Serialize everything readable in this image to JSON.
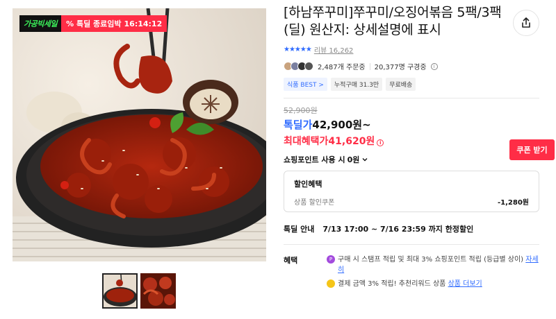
{
  "photo": {
    "promo_logo": "가공빅세일",
    "promo_label": "% 톡딜 종료임박",
    "promo_timer": "16:14:12"
  },
  "icons": {
    "share": "share-icon",
    "info": "info-icon",
    "chevron": "chevron-down-icon",
    "point": "point-badge-icon",
    "coin": "coin-icon"
  },
  "product": {
    "title": "[하남쭈꾸미]쭈꾸미/오징어볶음 5팩/3팩(딜) 원산지: 상세설명에 표시",
    "stars": "★★★★★",
    "review_label": "리뷰",
    "review_count": "16,262",
    "orders": "2,487개 주문중",
    "views": "20,377명 구경중",
    "tags": [
      "식품 BEST >",
      "누적구매 31.3만",
      "무료배송"
    ]
  },
  "price": {
    "original": "52,900원",
    "deal_label": "톡딜가",
    "deal_price": "42,900원~",
    "benefit_label": "최대혜택가",
    "benefit_price": "41,620원",
    "coupon_button": "쿠폰 받기",
    "points_label": "쇼핑포인트 사용 시",
    "points_value": "0원"
  },
  "discount": {
    "heading": "할인혜택",
    "item_label": "상품 할인쿠폰",
    "item_value": "-1,280원"
  },
  "deal_notice": {
    "label": "톡딜 안내",
    "period": "7/13 17:00 ~ 7/16 23:59 까지 한정할인"
  },
  "benefits": {
    "label": "혜택",
    "item1": "구매 시 스탬프 적립 및 최대 3% 쇼핑포인트 적립 (등급별 상이)",
    "item1_link": "자세히",
    "item2": "결제 금액 3% 적립! 추천리워드 상품",
    "item2_link": "상품 더보기"
  },
  "colors": {
    "accent_blue": "#2f6bff",
    "accent_red": "#ff2d46"
  }
}
